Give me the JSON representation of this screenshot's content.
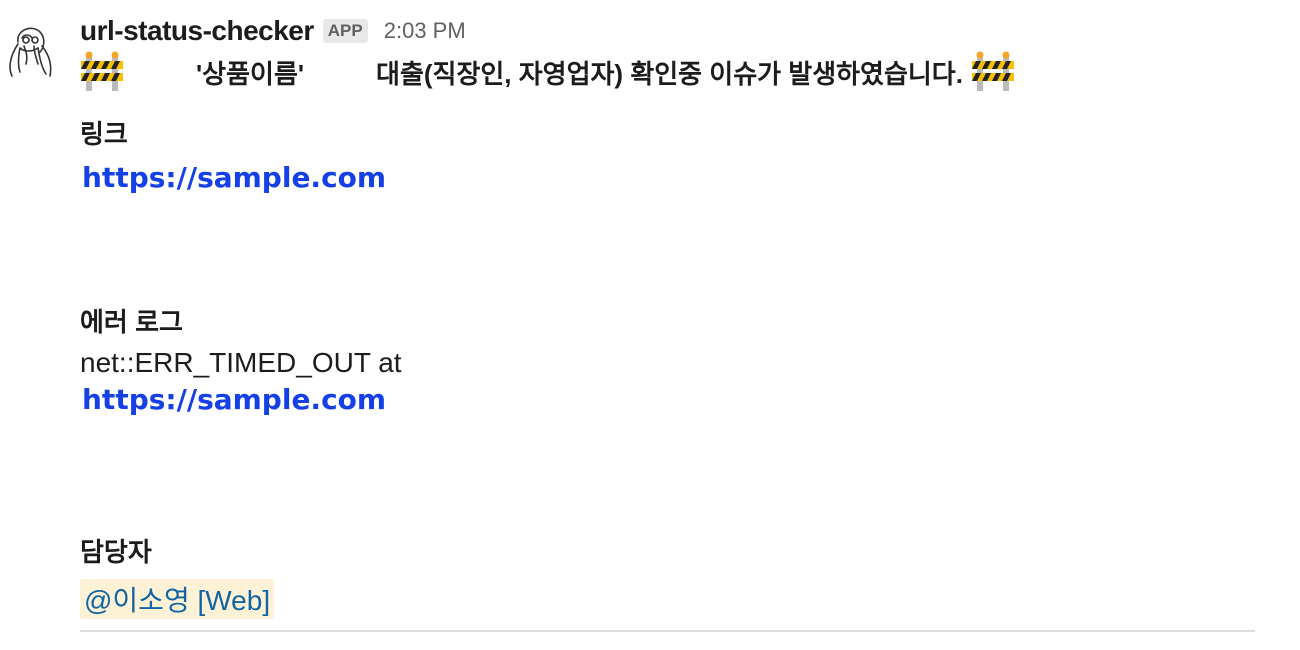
{
  "message": {
    "sender": "url-status-checker",
    "badge": "APP",
    "time": "2:03 PM",
    "alert": {
      "product": "'상품이름'",
      "text": "대출(직장인, 자영업자) 확인중 이슈가 발생하였습니다."
    },
    "sections": {
      "link_label": "링크",
      "link_url": "https://sample.com",
      "error_label": "에러 로그",
      "error_text": "net::ERR_TIMED_OUT at",
      "error_url": "https://sample.com",
      "owner_label": "담당자",
      "owner_mention": "@이소영 [Web]"
    }
  },
  "icons": {
    "avatar": "sketch-face-avatar",
    "alert_emoji": "construction-barrier-icon"
  },
  "colors": {
    "link": "#1540e6",
    "mention_bg": "#fdf2d6",
    "mention_text": "#1264a3",
    "badge_bg": "#e8e8e8"
  }
}
